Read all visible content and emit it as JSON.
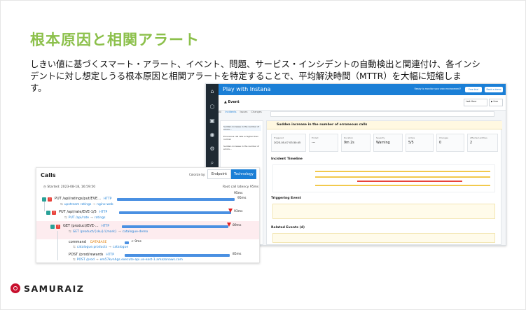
{
  "slide": {
    "title": "根本原因と相関アラート",
    "body": "しきい値に基づくスマート・アラート、イベント、問題、サービス・インシデントの自動検出と関連付け、各インシ\nデントに対し想定しうる根本原因と相関アラートを特定することで、平均解決時間（MTTR）を大幅に短縮しま\nす。"
  },
  "event_app": {
    "header_title": "Play with Instana",
    "header_question": "Ready to monitor your own environment?",
    "free_trial_label": "Free trial",
    "demo_label": "Book a demo",
    "event_title": "Event",
    "time_range": "Last Hour",
    "live_label": "Live",
    "tabs": [
      "All",
      "Incidents",
      "Issues",
      "Changes"
    ],
    "list_items": [
      "Sudden increase in the number of errors...",
      "Erroneous call rate is higher than normal",
      "Sudden increase in the number of errors..."
    ],
    "incident_title": "Sudden increase in the number of erroneous calls",
    "kpis": [
      {
        "label": "Triggered",
        "value": "2023-05-07 03:30:45"
      },
      {
        "label": "Ended",
        "value": "---"
      },
      {
        "label": "Duration",
        "value": "9m 2s"
      },
      {
        "label": "Severity",
        "value": "Warning"
      },
      {
        "label": "Active",
        "value": "5/5"
      },
      {
        "label": "Changes",
        "value": "0"
      },
      {
        "label": "Affected entities",
        "value": "2"
      }
    ],
    "section_timeline": "Incident Timeline",
    "section_triggering": "Triggering Event",
    "section_related": "Related Events (4)"
  },
  "calls": {
    "title": "Calls",
    "colorize_by": "Colorize by:",
    "endpoint_label": "Endpoint",
    "technology_label": "Technology",
    "started": "Started: 2023-08-18, 16:59:50",
    "root_latency": "Root call latency 95ms",
    "root_latency_value": "95ms",
    "rows": [
      {
        "name": "PUT /api/ratings/put/EVE...",
        "tech": "HTTP",
        "latency": "95ms",
        "sub_from": "upstream ratings",
        "sub_to": "nginx-web"
      },
      {
        "name": "PUT /api/rate/EVE-1/5",
        "tech": "HTTP",
        "latency": "93ms",
        "sub_from": "PUT /api/rate",
        "sub_to": "ratings"
      },
      {
        "name": "GET /product/EVE-...",
        "tech": "HTTP",
        "latency": "89ms",
        "sub_from": "GET /product/{sku}/{mark}",
        "sub_to": "catalogue-demo"
      },
      {
        "name": "command",
        "tech": "DATABASE",
        "latency": "< 9ms",
        "sub_from": "catalogue.products",
        "sub_to": "catalogue"
      },
      {
        "name": "POST /prod/rewards",
        "tech": "HTTP",
        "latency": "85ms",
        "sub_from": "POST /prod",
        "sub_to": "em57kvnhgs.execute-api.us-east-1.amazonaws.com"
      }
    ]
  },
  "brand": {
    "name": "SAMURAIZ",
    "accent": "#8cc04b",
    "logo_red": "#c8102e",
    "instana_blue": "#1b7fd6"
  }
}
